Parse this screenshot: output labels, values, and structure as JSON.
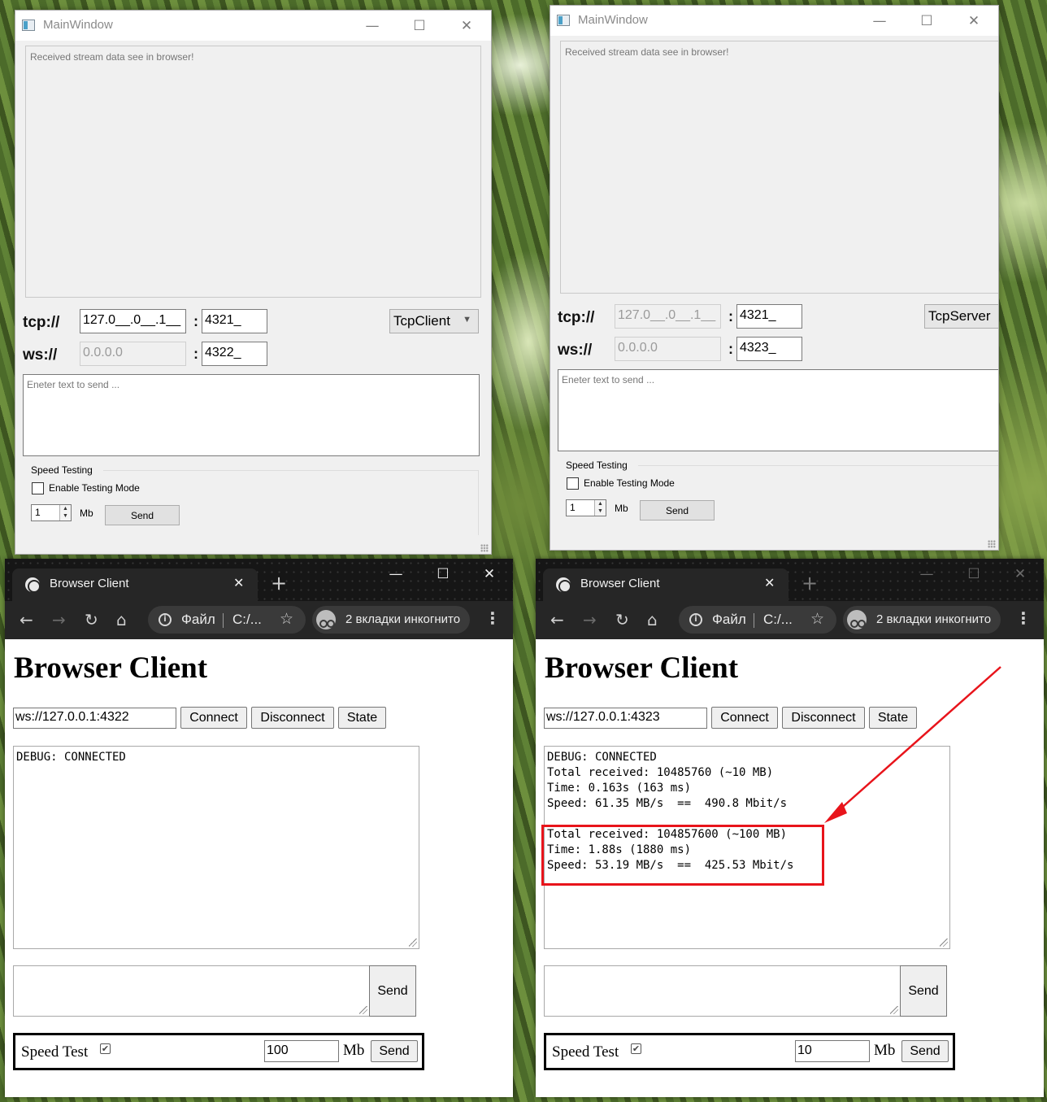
{
  "qt_windows": [
    {
      "title": "MainWindow",
      "output_text": "Received stream data see in browser!",
      "tcp_label": "tcp://",
      "tcp_ip": "127.0__.0__.1__",
      "tcp_port": "4321_",
      "ws_label": "ws://",
      "ws_ip": "0.0.0.0",
      "ws_port": "4322_",
      "mode": "TcpClient",
      "send_placeholder": "Eneter text to send ...",
      "speed_group": "Speed  Testing",
      "enable_testing": "Enable Testing Mode",
      "spin_value": "1",
      "mb_label": "Mb",
      "send_label": "Send"
    },
    {
      "title": "MainWindow",
      "output_text": "Received stream data see in browser!",
      "tcp_label": "tcp://",
      "tcp_ip": "127.0__.0__.1__",
      "tcp_port": "4321_",
      "ws_label": "ws://",
      "ws_ip": "0.0.0.0",
      "ws_port": "4323_",
      "mode": "TcpServer",
      "send_placeholder": "Eneter text to send ...",
      "speed_group": "Speed  Testing",
      "enable_testing": "Enable Testing Mode",
      "spin_value": "1",
      "mb_label": "Mb",
      "send_label": "Send"
    }
  ],
  "browsers": [
    {
      "tab_title": "Browser Client",
      "omnibox_file": "Файл",
      "omnibox_path": "C:/...",
      "incognito_text": "2 вкладки инкогнито",
      "heading": "Browser Client",
      "ws_url": "ws://127.0.0.1:4322",
      "connect_label": "Connect",
      "disconnect_label": "Disconnect",
      "state_label": "State",
      "log_text": "DEBUG: CONNECTED",
      "send_label": "Send",
      "speed_test_label": "Speed Test",
      "speed_test_checked": true,
      "speed_value": "100",
      "mb_label": "Mb",
      "speed_send_label": "Send"
    },
    {
      "tab_title": "Browser Client",
      "omnibox_file": "Файл",
      "omnibox_path": "C:/...",
      "incognito_text": "2 вкладки инкогнито",
      "heading": "Browser Client",
      "ws_url": "ws://127.0.0.1:4323",
      "connect_label": "Connect",
      "disconnect_label": "Disconnect",
      "state_label": "State",
      "log_text": "DEBUG: CONNECTED\nTotal received: 10485760 (~10 MB)\nTime: 0.163s (163 ms)\nSpeed: 61.35 MB/s  ==  490.8 Mbit/s\n\nTotal received: 104857600 (~100 MB)\nTime: 1.88s (1880 ms)\nSpeed: 53.19 MB/s  ==  425.53 Mbit/s",
      "send_label": "Send",
      "speed_test_label": "Speed Test",
      "speed_test_checked": true,
      "speed_value": "10",
      "mb_label": "Mb",
      "speed_send_label": "Send"
    }
  ],
  "glyphs": {
    "minimize": "—",
    "maximize": "☐",
    "close": "✕",
    "back": "←",
    "forward": "→",
    "reload": "↻",
    "home": "⌂",
    "star": "☆",
    "menu": "⋮",
    "new_tab": "+",
    "info": "i",
    "check": "✔",
    "combo_arrow": "▼",
    "spin_up": "▲",
    "spin_down": "▼"
  },
  "colors": {
    "highlight": "#e8141b",
    "arrow": "#e8141b"
  }
}
